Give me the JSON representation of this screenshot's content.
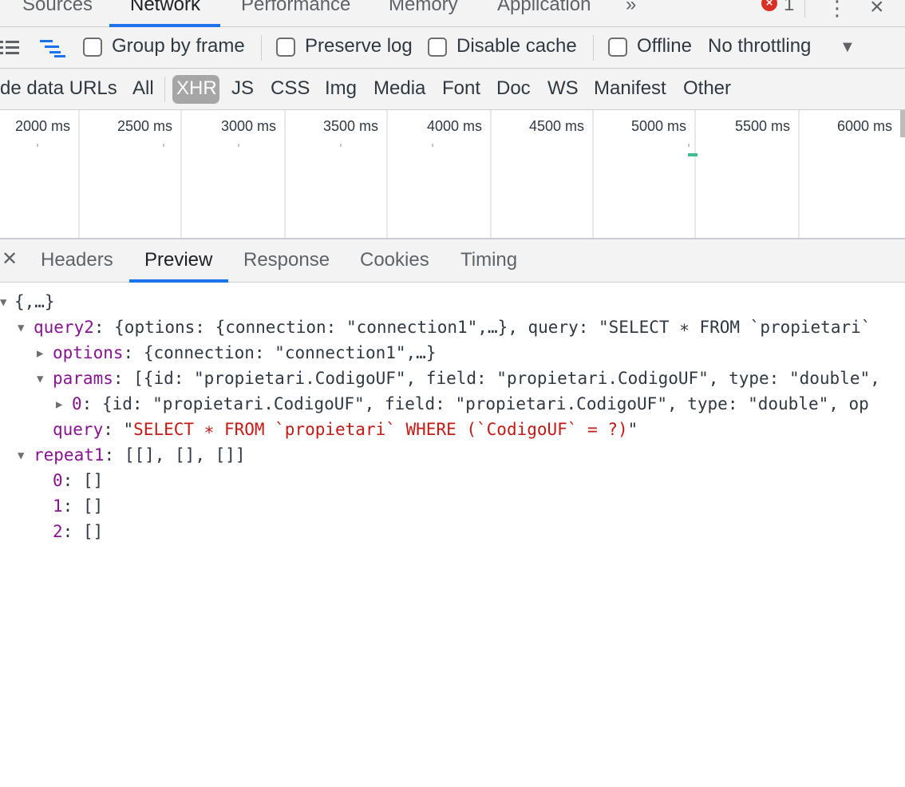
{
  "top_tabs": [
    {
      "label": "Sources"
    },
    {
      "label": "Network"
    },
    {
      "label": "Performance"
    },
    {
      "label": "Memory"
    },
    {
      "label": "Application"
    }
  ],
  "more_tabs_glyph": "»",
  "error_count": "1",
  "toolbar": {
    "group_by_frame": "Group by frame",
    "preserve_log": "Preserve log",
    "disable_cache": "Disable cache",
    "offline": "Offline",
    "throttling": "No throttling"
  },
  "filters": {
    "hide_data_urls": "de data URLs",
    "types": [
      "All",
      "XHR",
      "JS",
      "CSS",
      "Img",
      "Media",
      "Font",
      "Doc",
      "WS",
      "Manifest",
      "Other"
    ],
    "selected": "XHR"
  },
  "overview_ticks": [
    "2000 ms",
    "2500 ms",
    "3000 ms",
    "3500 ms",
    "4000 ms",
    "4500 ms",
    "5000 ms",
    "5500 ms",
    "6000 ms"
  ],
  "detail_tabs": [
    "Headers",
    "Preview",
    "Response",
    "Cookies",
    "Timing"
  ],
  "active_detail_tab": "Preview",
  "preview": {
    "root": "{,…}",
    "query2_key": "query2",
    "query2_summary": "{options: {connection: \"connection1\",…}, query: \"SELECT ∗ FROM `propietari`",
    "options_key": "options",
    "options_summary": "{connection: \"connection1\",…}",
    "params_key": "params",
    "params_summary": "[{id: \"propietari.CodigoUF\", field: \"propietari.CodigoUF\", type: \"double\",",
    "param0_key": "0",
    "param0_summary": "{id: \"propietari.CodigoUF\", field: \"propietari.CodigoUF\", type: \"double\", op",
    "query_key": "query",
    "query_value": "SELECT ∗ FROM `propietari` WHERE (`CodigoUF` = ?)",
    "repeat1_key": "repeat1",
    "repeat1_summary": "[[], [], []]",
    "repeat_items": [
      {
        "key": "0",
        "value": "[]"
      },
      {
        "key": "1",
        "value": "[]"
      },
      {
        "key": "2",
        "value": "[]"
      }
    ]
  }
}
